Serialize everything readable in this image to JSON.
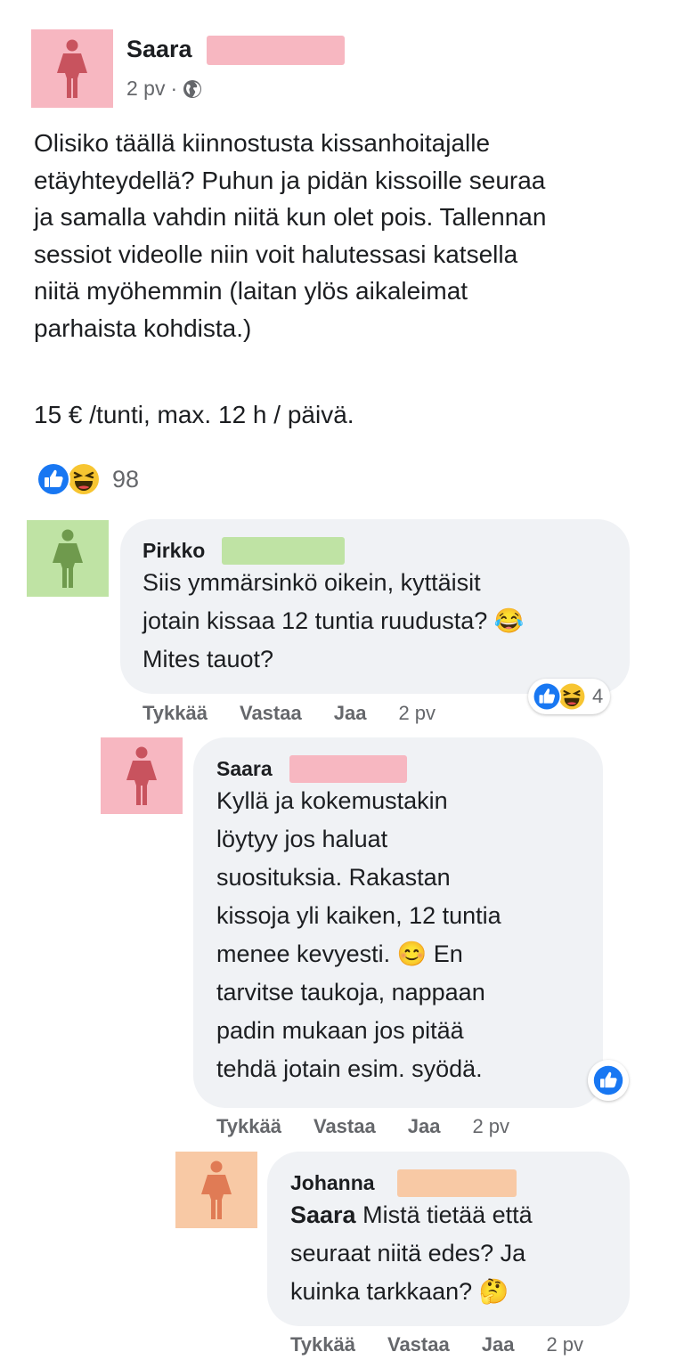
{
  "post": {
    "author": "Saara",
    "time": "2 pv",
    "separator": "·",
    "audience_icon": "globe-icon",
    "text_lines": [
      "Olisiko täällä kiinnostusta kissanhoitajalle",
      "etäyhteydellä? Puhun ja pidän kissoille seuraa",
      "ja samalla vahdin niitä kun olet pois. Tallennan",
      "sessiot videolle niin voit halutessasi katsella",
      "niitä myöhemmin (laitan ylös aikaleimat",
      "parhaista kohdista.)"
    ],
    "price_line": "15 € /tunti, max. 12 h / päivä.",
    "reactions": {
      "icons": [
        "like-icon",
        "haha-icon"
      ],
      "count": "98"
    }
  },
  "comments": [
    {
      "author": "Pirkko",
      "text_lines": [
        "Siis ymmärsinkö oikein, kyttäisit",
        "jotain kissaa 12 tuntia ruudusta? 😂",
        "Mites tauot?"
      ],
      "reactions": {
        "icons": [
          "like-icon",
          "haha-icon"
        ],
        "count": "4"
      },
      "actions": {
        "like": "Tykkää",
        "reply": "Vastaa",
        "share": "Jaa",
        "time": "2 pv"
      }
    },
    {
      "author": "Saara",
      "text_lines": [
        "Kyllä ja kokemustakin",
        "löytyy jos haluat",
        "suosituksia. Rakastan",
        "kissoja yli kaiken, 12 tuntia",
        "menee kevyesti. 😊 En",
        "tarvitse taukoja, nappaan",
        "padin mukaan jos pitää",
        "tehdä jotain esim. syödä."
      ],
      "reactions": {
        "icons": [
          "like-icon"
        ]
      },
      "actions": {
        "like": "Tykkää",
        "reply": "Vastaa",
        "share": "Jaa",
        "time": "2 pv"
      }
    },
    {
      "author": "Johanna",
      "mention": "Saara",
      "text_first": " Mistä tietää että",
      "text_lines": [
        "seuraat niitä edes? Ja",
        "kuinka tarkkaan? 🤔"
      ],
      "actions": {
        "like": "Tykkää",
        "reply": "Vastaa",
        "share": "Jaa",
        "time": "2 pv"
      }
    }
  ],
  "colors": {
    "saara_avatar": "#f7b7c1",
    "saara_figure": "#c8535e",
    "pirkko_avatar": "#bfe3a4",
    "pirkko_figure": "#6f9a4d",
    "johanna_avatar": "#f8c9a5",
    "johanna_figure": "#e07b55",
    "like_blue": "#1877f2",
    "haha_yellow": "#f7c531",
    "bubble": "#f0f2f5"
  }
}
